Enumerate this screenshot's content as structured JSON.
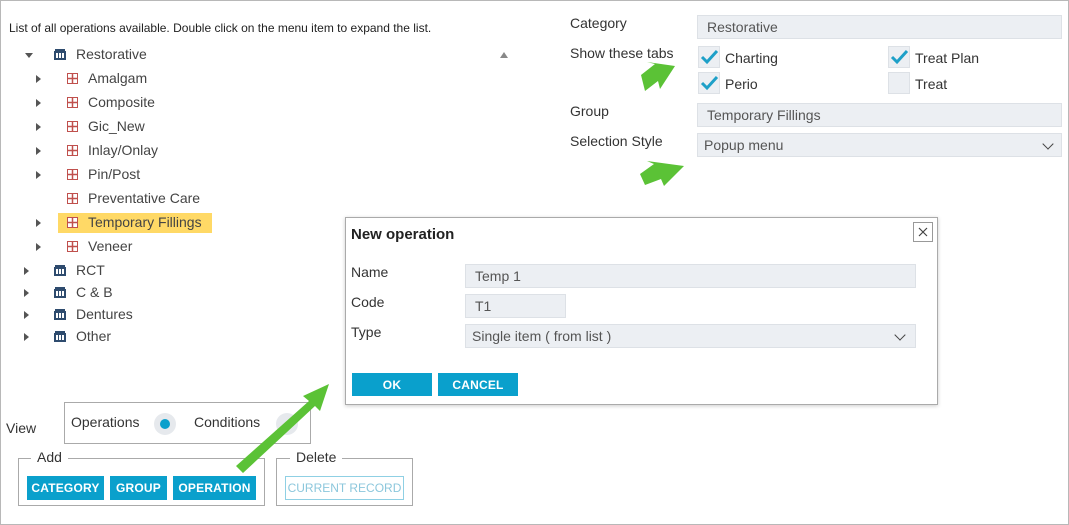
{
  "tree": {
    "instruction": "List of all operations available. Double click on the menu item to expand the list.",
    "categories": [
      {
        "label": "Restorative"
      },
      {
        "label": "RCT"
      },
      {
        "label": "C & B"
      },
      {
        "label": "Dentures"
      },
      {
        "label": "Other"
      }
    ],
    "groups": [
      {
        "label": "Amalgam"
      },
      {
        "label": "Composite"
      },
      {
        "label": "Gic_New"
      },
      {
        "label": "Inlay/Onlay"
      },
      {
        "label": "Pin/Post"
      },
      {
        "label": "Preventative Care"
      },
      {
        "label": "Temporary Fillings"
      },
      {
        "label": "Veneer"
      }
    ]
  },
  "form": {
    "category_label": "Category",
    "category_value": "Restorative",
    "tabs_label": "Show these tabs",
    "tabs": [
      {
        "label": "Charting",
        "checked": true
      },
      {
        "label": "Treat Plan",
        "checked": true
      },
      {
        "label": "Perio",
        "checked": true
      },
      {
        "label": "Treat",
        "checked": false
      }
    ],
    "group_label": "Group",
    "group_value": "Temporary Fillings",
    "selection_label": "Selection Style",
    "selection_value": "Popup menu"
  },
  "dialog": {
    "title": "New operation",
    "name_label": "Name",
    "name_value": "Temp 1",
    "code_label": "Code",
    "code_value": "T1",
    "type_label": "Type",
    "type_value": "Single item ( from list )",
    "ok_label": "OK",
    "cancel_label": "CANCEL"
  },
  "view": {
    "label": "View",
    "operations_label": "Operations",
    "conditions_label": "Conditions",
    "selected": "Operations"
  },
  "add": {
    "legend": "Add",
    "category_btn": "CATEGORY",
    "group_btn": "GROUP",
    "operation_btn": "OPERATION"
  },
  "delete": {
    "legend": "Delete",
    "current_btn": "CURRENT RECORD"
  },
  "colors": {
    "accent": "#0aa0cc",
    "selection": "#ffd966",
    "arrow": "#5bc236"
  },
  "icons": [
    "category-icon",
    "group-icon",
    "check-icon",
    "close-icon",
    "chevron-down-icon",
    "arrow-icon"
  ]
}
